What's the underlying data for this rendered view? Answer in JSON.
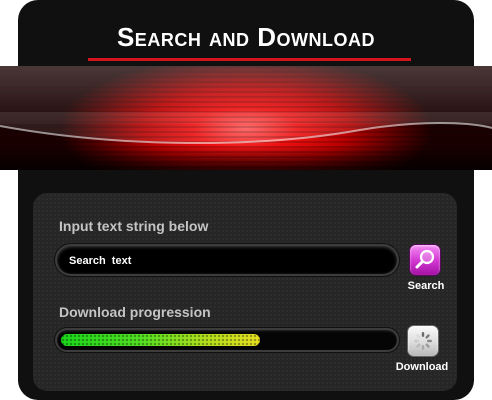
{
  "header": {
    "title": "Search and Download"
  },
  "search_section": {
    "label": "Input text string below",
    "input_value": "Search  text",
    "button_label": "Search",
    "button_icon": "magnifier-icon"
  },
  "download_section": {
    "label": "Download progression",
    "progress_fraction": 0.6,
    "button_label": "Download",
    "button_icon": "loading-spinner-icon"
  },
  "colors": {
    "accent_red": "#d4151b",
    "search_button": "#d43bd4",
    "progress_start": "#1bd81b",
    "progress_end": "#e8e020"
  }
}
